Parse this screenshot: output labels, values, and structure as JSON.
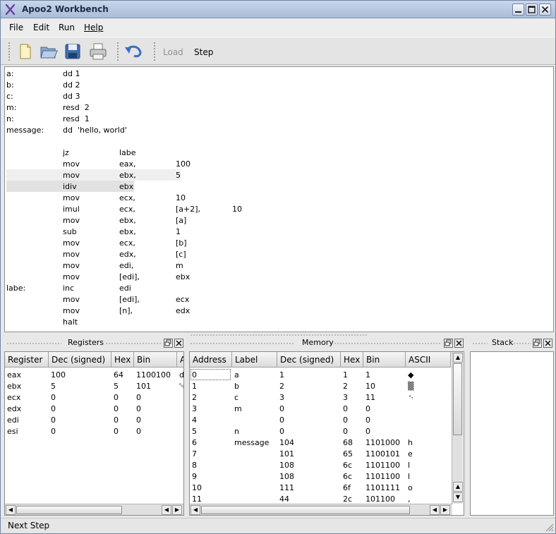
{
  "window": {
    "title": "Apoo2 Workbench"
  },
  "menu": [
    "File",
    "Edit",
    "Run",
    "Help"
  ],
  "toolbar": {
    "load_label": "Load",
    "step_label": "Step"
  },
  "editor": {
    "lines": [
      [
        "a:",
        "dd 1",
        "",
        "",
        ""
      ],
      [
        "b:",
        "dd 2",
        "",
        "",
        ""
      ],
      [
        "c:",
        "dd 3",
        "",
        "",
        ""
      ],
      [
        "m:",
        "resd  2",
        "",
        "",
        ""
      ],
      [
        "n:",
        "resd  1",
        "",
        "",
        ""
      ],
      [
        "message:",
        "dd  'hello, world'",
        "",
        "",
        ""
      ],
      [
        "",
        "",
        "",
        "",
        ""
      ],
      [
        "",
        "jz",
        "labe",
        "",
        ""
      ],
      [
        "",
        "mov",
        "eax,",
        "100",
        ""
      ],
      [
        "",
        "mov",
        "ebx,",
        "5",
        ""
      ],
      [
        "",
        "idiv",
        "ebx",
        "",
        ""
      ],
      [
        "",
        "mov",
        "ecx,",
        "10",
        ""
      ],
      [
        "",
        "imul",
        "ecx,",
        "[a+2],",
        "10"
      ],
      [
        "",
        "mov",
        "ebx,",
        "[a]",
        ""
      ],
      [
        "",
        "sub",
        "ebx,",
        "1",
        ""
      ],
      [
        "",
        "mov",
        "ecx,",
        "[b]",
        ""
      ],
      [
        "",
        "mov",
        "edx,",
        "[c]",
        ""
      ],
      [
        "",
        "mov",
        "edi,",
        "m",
        ""
      ],
      [
        "",
        "mov",
        "[edi],",
        "ebx",
        ""
      ],
      [
        "labe:",
        "inc",
        "edi",
        "",
        ""
      ],
      [
        "",
        "mov",
        "[edi],",
        "ecx",
        ""
      ],
      [
        "",
        "mov",
        "[n],",
        "edx",
        ""
      ],
      [
        "",
        "halt",
        "",
        "",
        ""
      ]
    ]
  },
  "registers": {
    "title": "Registers",
    "headers": [
      "Register",
      "Dec (signed)",
      "Hex",
      "Bin",
      "A"
    ],
    "rows": [
      [
        "eax",
        "100",
        "64",
        "1100100",
        "d"
      ],
      [
        "ebx",
        "5",
        "5",
        "101",
        "␅"
      ],
      [
        "ecx",
        "0",
        "0",
        "0",
        ""
      ],
      [
        "edx",
        "0",
        "0",
        "0",
        ""
      ],
      [
        "edi",
        "0",
        "0",
        "0",
        ""
      ],
      [
        "esi",
        "0",
        "0",
        "0",
        ""
      ]
    ]
  },
  "memory": {
    "title": "Memory",
    "headers": [
      "Address",
      "Label",
      "Dec (signed)",
      "Hex",
      "Bin",
      "ASCII"
    ],
    "rows": [
      [
        "0",
        "a",
        "1",
        "1",
        "1",
        "◆"
      ],
      [
        "1",
        "b",
        "2",
        "2",
        "10",
        "▒"
      ],
      [
        "2",
        "c",
        "3",
        "3",
        "11",
        "␉"
      ],
      [
        "3",
        "m",
        "0",
        "0",
        "0",
        ""
      ],
      [
        "4",
        "",
        "0",
        "0",
        "0",
        ""
      ],
      [
        "5",
        "n",
        "0",
        "0",
        "0",
        ""
      ],
      [
        "6",
        "message",
        "104",
        "68",
        "1101000",
        "h"
      ],
      [
        "7",
        "",
        "101",
        "65",
        "1100101",
        "e"
      ],
      [
        "8",
        "",
        "108",
        "6c",
        "1101100",
        "l"
      ],
      [
        "9",
        "",
        "108",
        "6c",
        "1101100",
        "l"
      ],
      [
        "10",
        "",
        "111",
        "6f",
        "1101111",
        "o"
      ],
      [
        "11",
        "",
        "44",
        "2c",
        "101100",
        ","
      ]
    ]
  },
  "stack": {
    "title": "Stack"
  },
  "status": {
    "text": "Next Step"
  }
}
